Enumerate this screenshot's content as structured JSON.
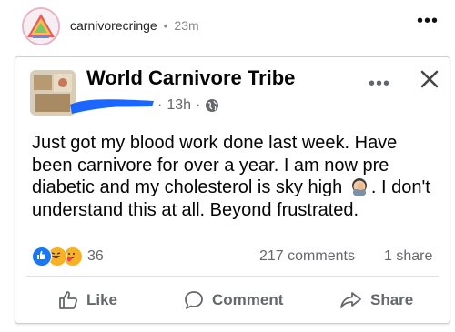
{
  "outer": {
    "username": "carnivorecringe",
    "separator": "•",
    "time": "23m",
    "more_label": "•••"
  },
  "post": {
    "group_name": "World Carnivore Tribe",
    "time": "13h",
    "meta_sep": "·",
    "more_label": "•••",
    "text_before_emoji": "Just got my blood work done last week. Have been carnivore for over a year. I am now pre diabetic and my cholesterol is sky high ",
    "text_after_emoji": ". I don't understand this at all. Beyond frustrated.",
    "reaction_count": "36",
    "comments": "217 comments",
    "shares": "1 share"
  },
  "actions": {
    "like": "Like",
    "comment": "Comment",
    "share": "Share"
  },
  "colors": {
    "like_blue": "#1877f2",
    "haha_yellow": "#f7b125",
    "redaction_blue": "#1a66ff",
    "muted_text": "#65676b"
  },
  "icons": {
    "inline_emoji": "face-palm-emoji",
    "globe": "globe-icon",
    "close": "close-icon"
  }
}
